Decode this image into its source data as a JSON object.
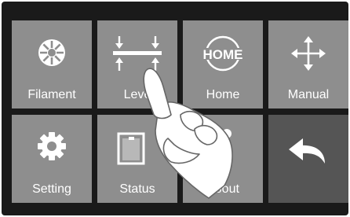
{
  "menu": {
    "tiles": [
      {
        "label": "Filament",
        "icon": "filament-icon"
      },
      {
        "label": "Leve",
        "icon": "level-icon"
      },
      {
        "label": "Home",
        "icon": "home-icon",
        "icon_text": "HOME"
      },
      {
        "label": "Manual",
        "icon": "move-arrows-icon"
      },
      {
        "label": "Setting",
        "icon": "gear-icon"
      },
      {
        "label": "Status",
        "icon": "printer-icon"
      },
      {
        "label": "About",
        "icon": "info-icon"
      },
      {
        "label": "",
        "icon": "back-arrow-icon"
      }
    ]
  },
  "colors": {
    "screen_bg": "#1a1a1a",
    "tile_bg": "#8e8e8e",
    "back_tile_bg": "#555555",
    "text": "#ffffff"
  }
}
